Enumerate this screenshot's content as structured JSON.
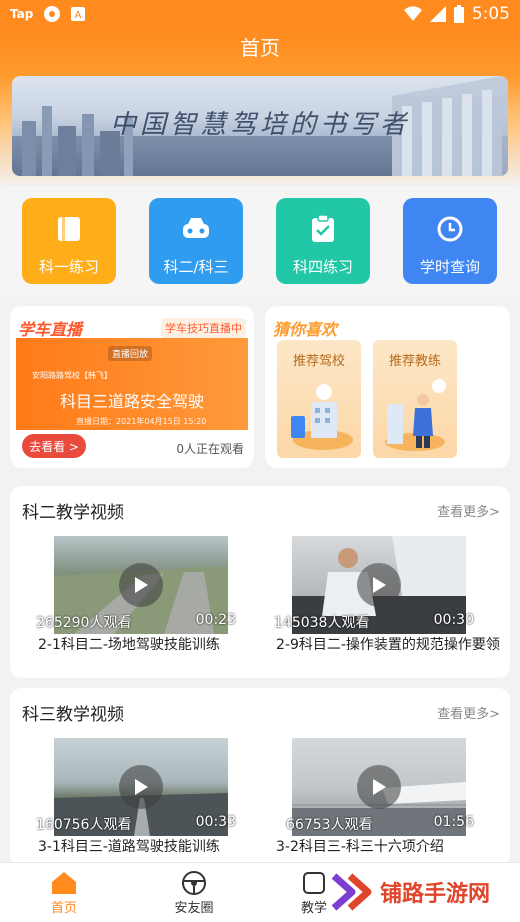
{
  "status_bar": {
    "app_tag": "Tap",
    "time": "5:05"
  },
  "page": {
    "title": "首页"
  },
  "banner": {
    "text": "中国智慧驾培的书写者"
  },
  "quick_actions": [
    {
      "label": "科一练习",
      "color": "#ffae1a"
    },
    {
      "label": "科二/科三",
      "color": "#2f9cf0"
    },
    {
      "label": "科四练习",
      "color": "#22c7a8"
    },
    {
      "label": "学时查询",
      "color": "#3f86f2"
    }
  ],
  "live": {
    "title": "学车直播",
    "tag": "学车技巧直播中",
    "rec_badge": "直播回放",
    "school": "安阳路路驾校【韩飞】",
    "subject": "科目三道路安全驾驶",
    "date": "直播日期：2021年04月15日 15:20",
    "go_button": "去看看 >",
    "watching": "0人正在观看"
  },
  "guess": {
    "title": "猜你喜欢",
    "items": [
      {
        "label": "推荐驾校"
      },
      {
        "label": "推荐教练"
      }
    ]
  },
  "section_two": {
    "title": "科二教学视频",
    "more": "查看更多>",
    "videos": [
      {
        "views": "265290人观看",
        "duration": "00:23",
        "title": "2-1科目二-场地驾驶技能训练"
      },
      {
        "views": "145038人观看",
        "duration": "00:30",
        "title": "2-9科目二-操作装置的规范操作要领"
      }
    ]
  },
  "section_three": {
    "title": "科三教学视频",
    "more": "查看更多>",
    "videos": [
      {
        "views": "160756人观看",
        "duration": "00:33",
        "title": "3-1科目三-道路驾驶技能训练"
      },
      {
        "views": "66753人观看",
        "duration": "01:56",
        "title": "3-2科目三-科三十六项介绍"
      }
    ]
  },
  "tabs": [
    {
      "label": "首页",
      "icon": "home-icon"
    },
    {
      "label": "安友圈",
      "icon": "steering-wheel-icon"
    },
    {
      "label": "教学",
      "icon": "teaching-icon"
    }
  ],
  "watermark": {
    "text": "铺路手游网"
  },
  "colors": {
    "brand": "#ff8a1e",
    "accent_red": "#e94a3c"
  }
}
